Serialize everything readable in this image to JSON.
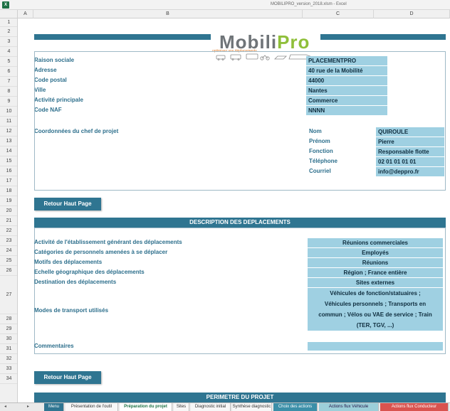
{
  "window": {
    "app_icon": "X",
    "title": "MOBILIPRO_version_2018.xlsm - Excel"
  },
  "columns": [
    "A",
    "B",
    "C",
    "D"
  ],
  "rows": [
    "1",
    "2",
    "3",
    "4",
    "5",
    "6",
    "7",
    "8",
    "9",
    "10",
    "11",
    "12",
    "13",
    "14",
    "15",
    "16",
    "17",
    "18",
    "19",
    "20",
    "21",
    "22",
    "23",
    "24",
    "25",
    "26",
    "27",
    "28",
    "29",
    "30",
    "31",
    "32",
    "33",
    "34"
  ],
  "logo": {
    "mobili": "Mobili",
    "pro": "Pro",
    "tagline": "optimisez vos déplacements"
  },
  "company": {
    "labels": [
      "Raison sociale",
      "Adresse",
      "Code postal",
      "Ville",
      "Activité principale",
      "Code NAF"
    ],
    "values": [
      "PLACEMENTPRO",
      "40 rue de la Mobilité",
      "44000",
      "Nantes",
      "Commerce",
      "NNNN"
    ]
  },
  "chef": {
    "title": "Coordonnées du chef de projet",
    "labels": [
      "Nom",
      "Prénom",
      "Fonction",
      "Téléphone",
      "Courriel"
    ],
    "values": [
      "QUIROULE",
      "Pierre",
      "Responsable flotte",
      "02 01 01 01 01",
      "info@deppro.fr"
    ]
  },
  "buttons": {
    "retour_haut_page": "Retour Haut Page"
  },
  "description": {
    "header": "DESCRIPTION DES DEPLACEMENTS",
    "labels": [
      "Activité de l'établissement générant des déplacements",
      "Catégories de personnels amenées à se déplacer",
      "Motifs des déplacements",
      "Echelle géographique des déplacements",
      "Destination des déplacements"
    ],
    "values": [
      "Réunions commerciales",
      "Employés",
      "Réunions",
      "Région ; France entière",
      "Sites externes"
    ],
    "modes_label": "Modes de transport utilisés",
    "modes_lines": [
      "Véhicules de fonction/statuaires ;",
      "Véhicules personnels ; Transports en",
      "commun ; Vélos ou VAE de service ; Train",
      "(TER, TGV, ...)"
    ],
    "commentaires_label": "Commentaires"
  },
  "perimetre": {
    "header": "PERIMETRE DU PROJET"
  },
  "tabs": [
    {
      "label": "Menu",
      "style": "menu"
    },
    {
      "label": "Présentation de l'outil",
      "style": ""
    },
    {
      "label": "Préparation du projet",
      "style": "active"
    },
    {
      "label": "Sites",
      "style": ""
    },
    {
      "label": "Diagnostic initial",
      "style": ""
    },
    {
      "label": "Synthèse diagnostic",
      "style": ""
    },
    {
      "label": "Choix des actions",
      "style": "teal"
    },
    {
      "label": "Actions flux Véhicule",
      "style": "green"
    },
    {
      "label": "Actions flux Conducteur",
      "style": "red"
    }
  ],
  "colors": {
    "accent": "#2f7591",
    "cell_fill": "#9fd0e2",
    "label_text": "#2d6f8c",
    "excel_green": "#1e7145"
  }
}
